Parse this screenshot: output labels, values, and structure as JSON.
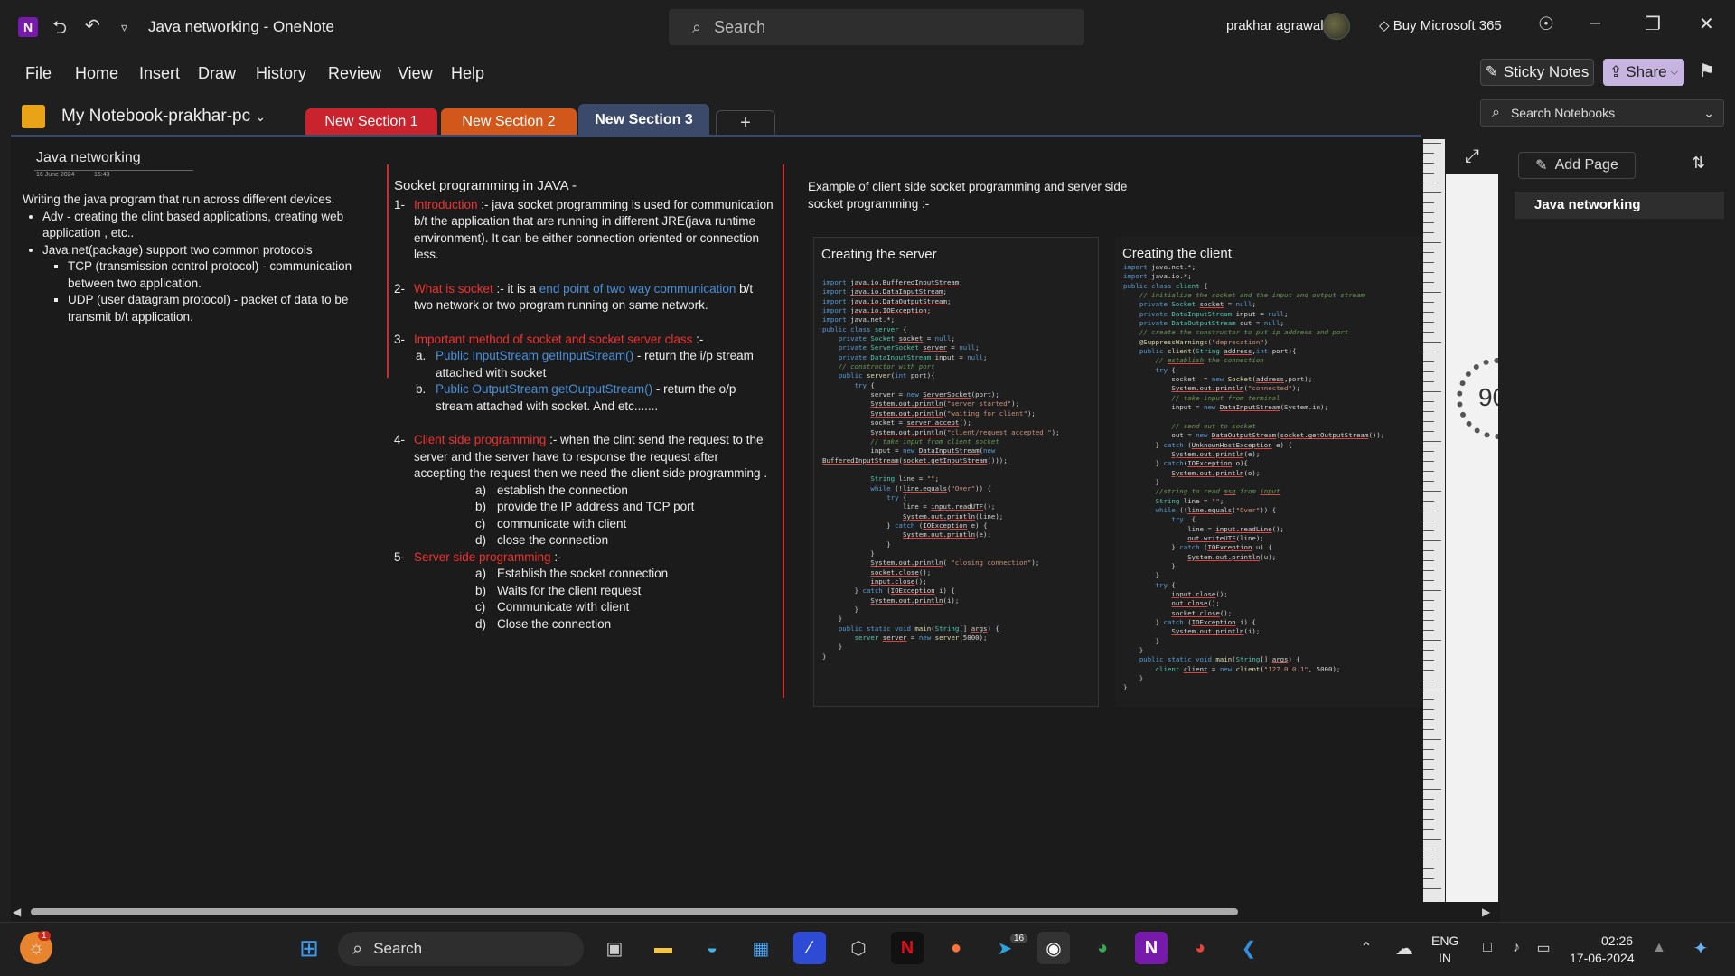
{
  "titlebar": {
    "app_icon_letter": "N",
    "title": "Java networking  -  OneNote",
    "search_placeholder": "Search",
    "user": "prakhar agrawal",
    "buy": "Buy Microsoft 365"
  },
  "menu": {
    "items": [
      "File",
      "Home",
      "Insert",
      "Draw",
      "History",
      "Review",
      "View",
      "Help"
    ],
    "sticky_notes": "Sticky Notes",
    "share": "Share"
  },
  "notebook": {
    "name": "My Notebook-prakhar-pc",
    "tabs": [
      {
        "label": "New Section 1",
        "color": "#c9242d"
      },
      {
        "label": "New Section 2",
        "color": "#d1571a"
      },
      {
        "label": "New Section 3",
        "color": "#3b4a6b"
      }
    ],
    "add_tab": "+",
    "search_placeholder": "Search Notebooks"
  },
  "page": {
    "title": "Java networking",
    "date": "16 June 2024",
    "time": "15:43",
    "col1": {
      "intro": "Writing the java program that run across different devices.",
      "adv": "Adv - creating the clint based applications, creating web application , etc..",
      "pkg": "Java.net(package) support two common protocols",
      "tcp": "TCP (transmission control protocol) - communication between two application.",
      "udp": "UDP (user datagram protocol) - packet of data to be transmit b/t application."
    },
    "col2": {
      "heading": "Socket programming in JAVA -",
      "i1_num": "1-",
      "i1_red": "Introduction",
      "i1_text": " :-  java socket programming is used for communication b/t the application that are running in different JRE(java runtime environment). It  can be either connection oriented or connection less.",
      "i2_num": "2-",
      "i2_red": "What is socket",
      "i2_a": " :- it is a ",
      "i2_blue": "end point of two way communication",
      "i2_b": " b/t two network or two program running on same network.",
      "i3_num": "3-",
      "i3_red": "Important method of socket and socket server class",
      "i3_text": " :-",
      "i3a_l": "a.",
      "i3a_blue": "Public InputStream getInputStream()",
      "i3a_text": " - return the i/p stream attached with socket",
      "i3b_l": "b.",
      "i3b_blue": "Public OutputStream getOutputStream()",
      "i3b_text": " - return the o/p stream attached with socket. And etc.......",
      "i4_num": "4-",
      "i4_red": "Client side programming",
      "i4_text": " :- when the clint send the request to the server and the server have to response the request after accepting the request then we need the client side programming .",
      "i4_steps": [
        {
          "l": "a)",
          "t": "establish the connection"
        },
        {
          "l": "b)",
          "t": "provide the IP address and TCP port"
        },
        {
          "l": "c)",
          "t": "communicate with client"
        },
        {
          "l": "d)",
          "t": "close the connection"
        }
      ],
      "i5_num": "5-",
      "i5_red": "Server side programming",
      "i5_text": " :-",
      "i5_steps": [
        {
          "l": "a)",
          "t": "Establish the socket connection"
        },
        {
          "l": "b)",
          "t": "Waits for the client request"
        },
        {
          "l": "c)",
          "t": "Communicate with client"
        },
        {
          "l": "d)",
          "t": "Close the connection"
        }
      ]
    },
    "col3": {
      "example": "Example of client side socket programming and server side socket programming :-",
      "server_title": "Creating the server",
      "client_title": "Creating the client"
    }
  },
  "side": {
    "gauge_value": "90"
  },
  "pages_pane": {
    "add_page": "Add Page",
    "pages": [
      "Java networking"
    ]
  },
  "taskbar": {
    "search": "Search",
    "notification_badge": "1",
    "telegram_badge": "16",
    "lang_top": "ENG",
    "lang_bottom": "IN",
    "time": "02:26",
    "date": "17-06-2024"
  }
}
